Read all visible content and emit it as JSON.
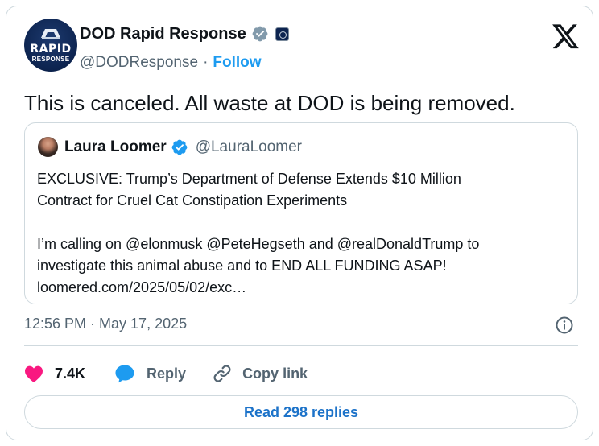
{
  "author": {
    "display_name": "DOD Rapid Response",
    "handle": "@DODResponse",
    "separator": "·",
    "follow_label": "Follow",
    "avatar_text_line1": "RAPID",
    "avatar_text_line2": "RESPONSE",
    "verified_badge_color": "#829aab",
    "avatar_color": "#0d2450"
  },
  "tweet": {
    "text": "This is canceled. All waste at DOD is being removed."
  },
  "quoted_tweet": {
    "display_name": "Laura Loomer",
    "handle": "@LauraLoomer",
    "verified_badge_color": "#1d9bf0",
    "text": "EXCLUSIVE: Trump’s Department of Defense Extends $10 Million\nContract for Cruel Cat Constipation Experiments\n\nI’m calling on @elonmusk @PeteHegseth and @realDonaldTrump to\ninvestigate this animal abuse and to END ALL FUNDING ASAP!\nloomered.com/2025/05/02/exc…"
  },
  "meta": {
    "timestamp": "12:56 PM · May 17, 2025"
  },
  "actions": {
    "like_count": "7.4K",
    "reply_label": "Reply",
    "copy_link_label": "Copy link"
  },
  "read_replies_label": "Read 298 replies",
  "colors": {
    "accent": "#1d9bf0",
    "like_heart": "#f91880",
    "reply_bubble": "#1d9bf0",
    "secondary_text": "#536471",
    "border": "#cfd9de"
  },
  "icons": [
    "x-logo-icon",
    "verified-badge-icon",
    "affiliate-badge-icon",
    "info-icon",
    "heart-icon",
    "reply-bubble-icon",
    "link-icon"
  ]
}
